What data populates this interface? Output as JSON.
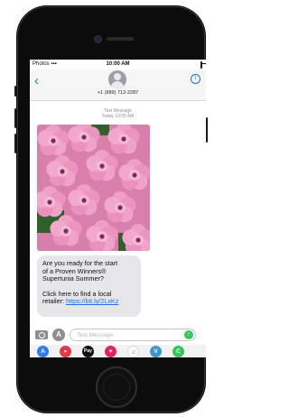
{
  "status": {
    "left": "Photos",
    "time": "10:00 AM"
  },
  "header": {
    "back_glyph": "‹",
    "phone": "+1 (989) 712-2287",
    "info_glyph": "i"
  },
  "thread": {
    "service": "Text Message",
    "timestamp": "Today 10:00 AM"
  },
  "photo": {
    "subject": "pink petunia flowers",
    "colors": {
      "petal": "#ef9ec6",
      "petal_light": "#f6c4dc",
      "center": "#7a2e57",
      "leaf": "#2f5f2a"
    }
  },
  "message": {
    "line1": "Are you ready for the start",
    "line2": "of a Proven Winners®",
    "line3": "Supertunia Summer?",
    "line4": "Click here to find a local",
    "line5_prefix": "retailer: ",
    "link": "https://bit.ly/2LxKz"
  },
  "compose": {
    "placeholder": "Text Message"
  },
  "apps": [
    {
      "icon": "app-store-icon",
      "color": "#2f7cf6",
      "glyph": "A"
    },
    {
      "icon": "web-search-icon",
      "color": "#e8364f",
      "glyph": "⌕"
    },
    {
      "icon": "apple-pay-icon",
      "color": "#111111",
      "glyph": "Pay"
    },
    {
      "icon": "digital-touch-icon",
      "color": "#e91e63",
      "glyph": "♥"
    },
    {
      "icon": "music-icon",
      "color": "#ffffff",
      "glyph": "♫"
    },
    {
      "icon": "venmo-icon",
      "color": "#3d95ce",
      "glyph": "V"
    }
  ],
  "colors": {
    "ios_blue": "#1a73e8",
    "bubble_gray": "#e5e5ea",
    "send_green": "#34c759"
  }
}
